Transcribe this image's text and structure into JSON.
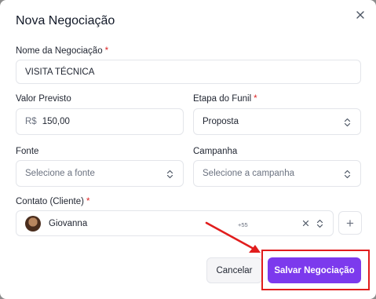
{
  "modal": {
    "title": "Nova Negociação",
    "close_icon": "close-icon"
  },
  "form": {
    "name": {
      "label": "Nome da Negociação",
      "required": "*",
      "value": "VISITA TÉCNICA"
    },
    "value": {
      "label": "Valor Previsto",
      "prefix": "R$",
      "value": "150,00"
    },
    "stage": {
      "label": "Etapa do Funil",
      "required": "*",
      "value": "Proposta"
    },
    "source": {
      "label": "Fonte",
      "placeholder": "Selecione a fonte"
    },
    "campaign": {
      "label": "Campanha",
      "placeholder": "Selecione a campanha"
    },
    "contact": {
      "label": "Contato (Cliente)",
      "required": "*",
      "value": "Giovanna",
      "country_code": "+55",
      "add_label": "+"
    }
  },
  "actions": {
    "cancel_label": "Cancelar",
    "save_label": "Salvar Negociação"
  },
  "annotation": {
    "color": "#e11d1d"
  },
  "colors": {
    "accent": "#7c3aed"
  }
}
